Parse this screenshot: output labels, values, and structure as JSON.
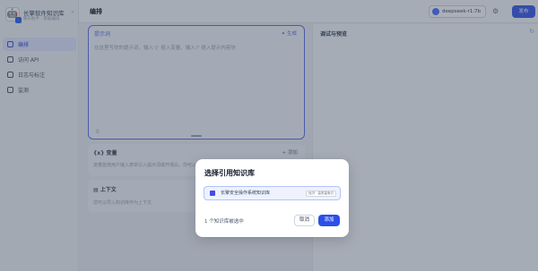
{
  "app": {
    "name": "长擎软件知识库",
    "subtitle": "聊天助手 · 基础编排",
    "avatar_icon": "robot-icon"
  },
  "sidebar": {
    "items": [
      {
        "label": "编排",
        "icon": "layout-icon",
        "active": true
      },
      {
        "label": "访问 API",
        "icon": "terminal-icon",
        "active": false
      },
      {
        "label": "日志与标注",
        "icon": "file-text-icon",
        "active": false
      },
      {
        "label": "监测",
        "icon": "dashboard-icon",
        "active": false
      }
    ]
  },
  "header": {
    "title": "编排",
    "model": "deepseek-r1:7b",
    "publish_label": "发布"
  },
  "prompt": {
    "title": "提示词",
    "generate_label": "生成",
    "placeholder": "在这里写你的提示词，输入'{' 插入变量、输入'/' 插入提示内容块",
    "count": "0"
  },
  "variables": {
    "title": "变量",
    "add_label": "添加",
    "description": "变量能使用户输入表单引入提示词或开场白，你可以试试在提示词中输入 {{input}}"
  },
  "context": {
    "title": "上下文",
    "description": "您可以导入知识库作为上下文"
  },
  "debug": {
    "title": "调试与预览"
  },
  "modal": {
    "title": "选择引用知识库",
    "kb_item_name": "长擎安全操作系统知识库",
    "kb_item_meta": "经济 · 高质量索引",
    "selected_count": "1 个知识库被选中",
    "cancel_label": "取消",
    "add_label": "添加"
  },
  "colors": {
    "primary": "#2b4fe8",
    "selected_bg": "#eef2ff",
    "selected_border": "#b2c3f7"
  }
}
